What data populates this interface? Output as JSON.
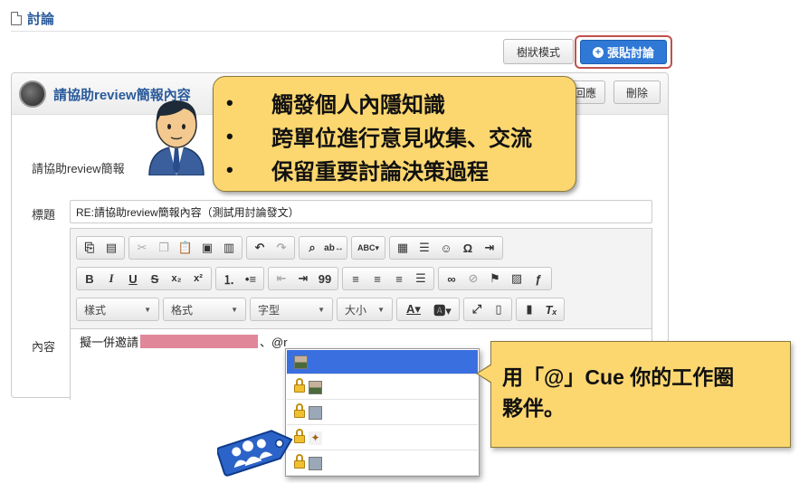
{
  "page": {
    "title": "討論"
  },
  "actions": {
    "tree_mode": "樹狀模式",
    "post": "張貼討論"
  },
  "topic": {
    "title": "請協助review簡報內容",
    "reply": "回應",
    "delete": "刪除"
  },
  "form": {
    "prefill_label": "請協助review簡報",
    "subject_label": "標題",
    "subject_value": "RE:請協助review簡報內容（測試用討論發文）",
    "content_label": "內容",
    "content_prefix": "擬一併邀請",
    "content_suffix": "、@r"
  },
  "toolbar": {
    "style": "樣式",
    "format": "格式",
    "font": "字型",
    "size": "大小",
    "bold": "B",
    "italic": "I",
    "underline": "U",
    "strike": "S",
    "subscript": "x₂",
    "superscript": "x²",
    "quote": "99",
    "omega": "Ω"
  },
  "callout_features": {
    "items": [
      "觸發個人內隱知識",
      "跨單位進行意見收集、交流",
      "保留重要討論決策過程"
    ]
  },
  "callout_mention": {
    "line1": "用「@」Cue 你的工作圈",
    "line2": "夥伴。"
  },
  "colors": {
    "accent": "#2f78d6",
    "highlight_border": "#c0504d",
    "callout_bg": "#fcd770",
    "selected_row": "#3a6fe0",
    "title_text": "#2a5a9a"
  }
}
